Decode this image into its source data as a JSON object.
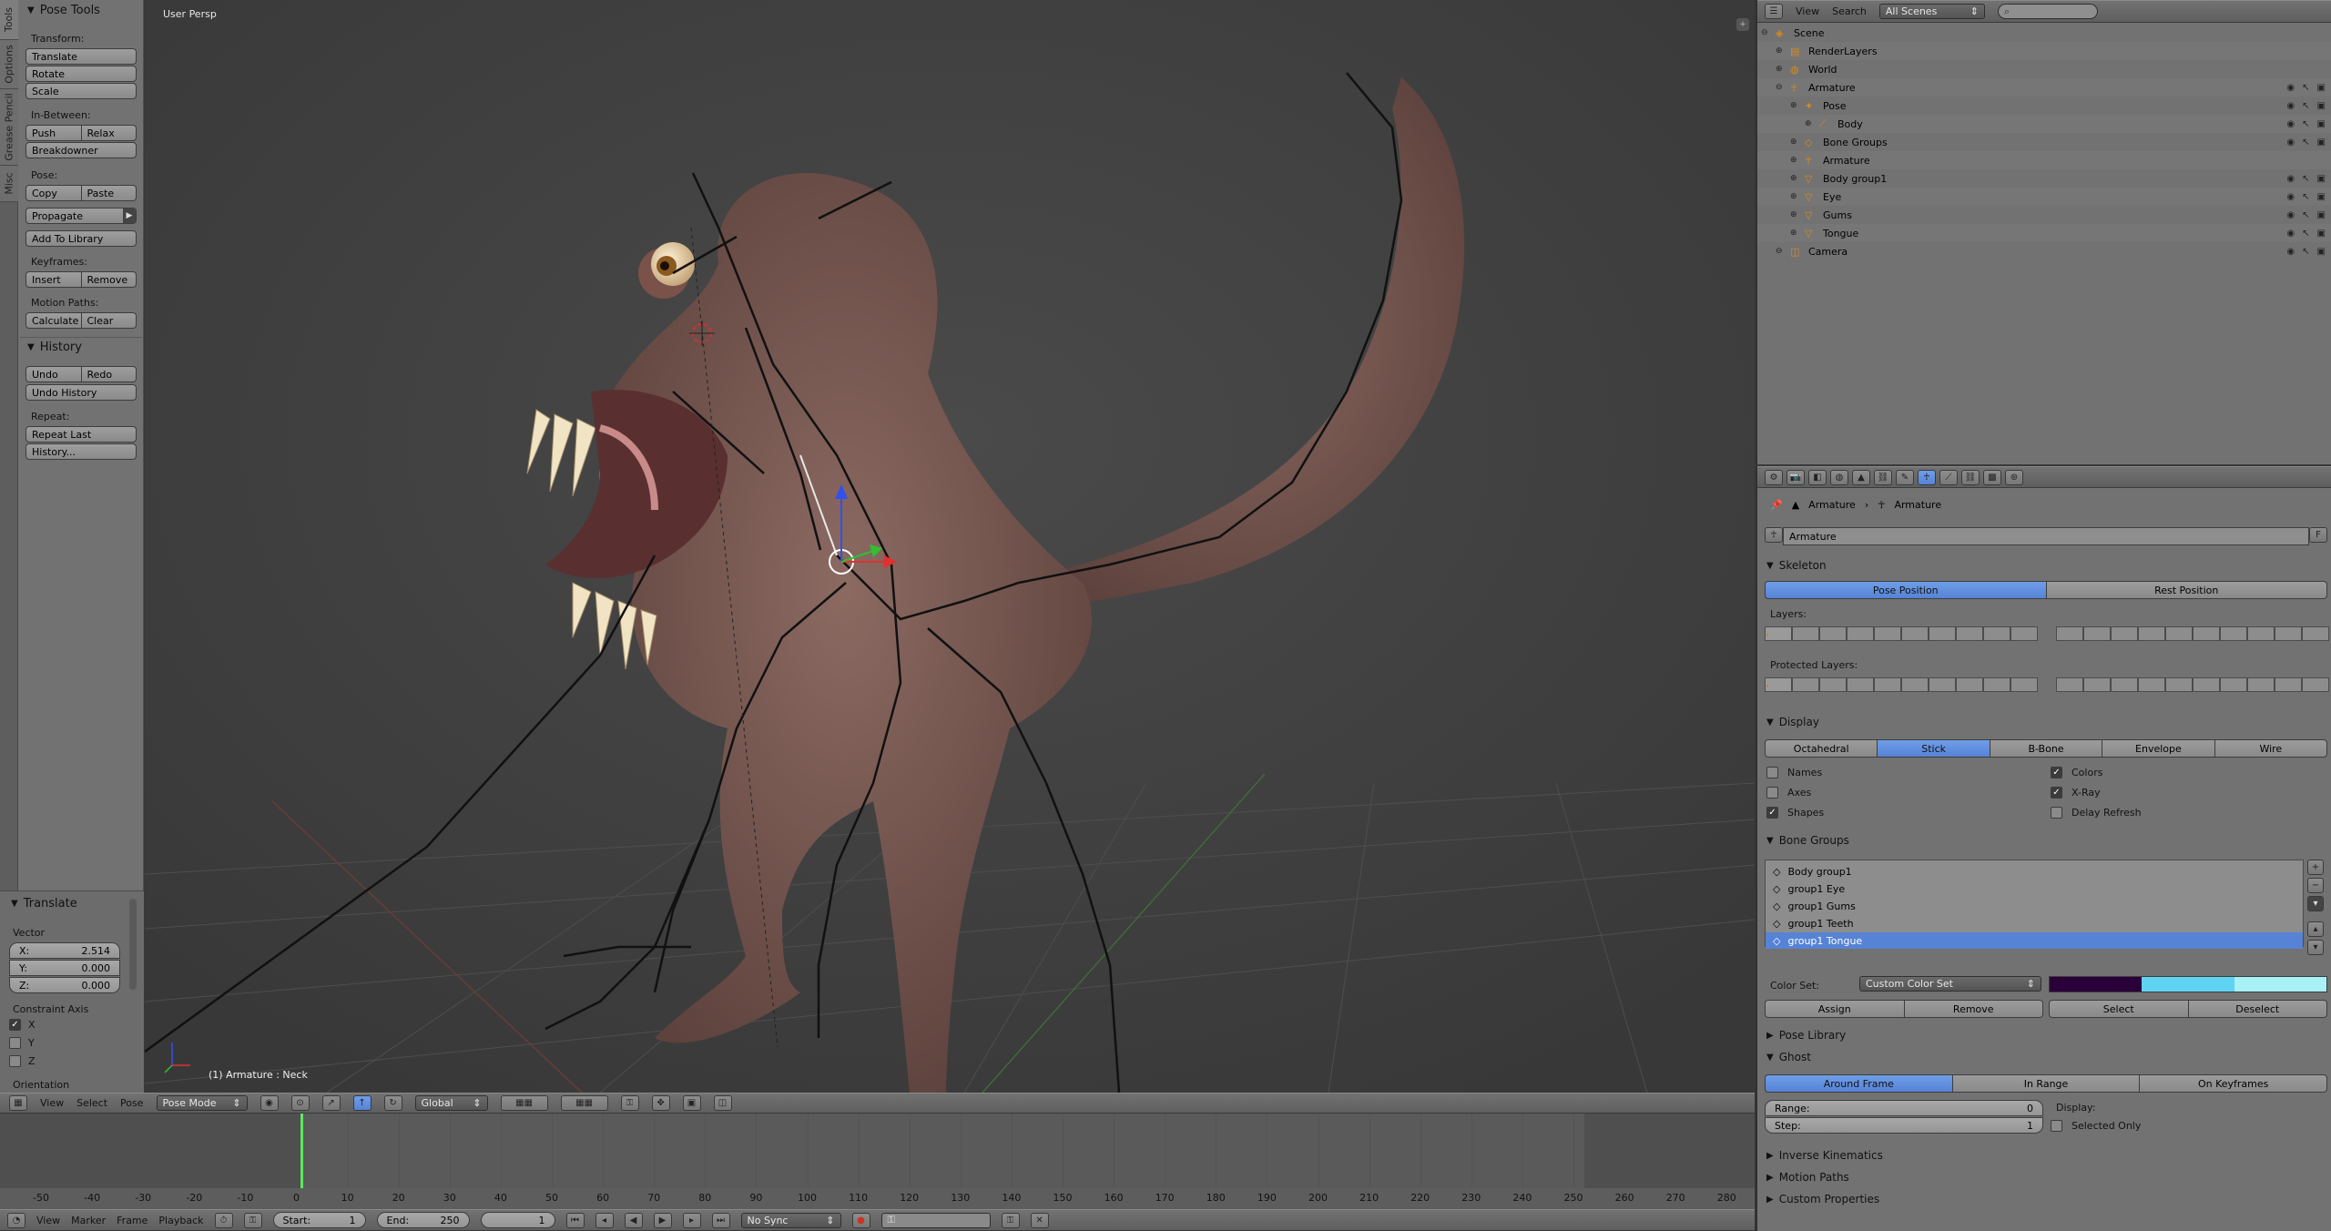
{
  "tool_shelf": {
    "tabs": [
      "Tools",
      "Options",
      "Grease Pencil",
      "Misc"
    ],
    "pose_tools_title": "Pose Tools",
    "transform_label": "Transform:",
    "translate": "Translate",
    "rotate": "Rotate",
    "scale": "Scale",
    "inbetween_label": "In-Between:",
    "push": "Push",
    "relax": "Relax",
    "breakdowner": "Breakdowner",
    "pose_label": "Pose:",
    "copy": "Copy",
    "paste": "Paste",
    "propagate": "Propagate",
    "add_to_library": "Add To Library",
    "keyframes_label": "Keyframes:",
    "insert": "Insert",
    "remove": "Remove",
    "motion_paths_label": "Motion Paths:",
    "calculate": "Calculate",
    "clear": "Clear",
    "history_title": "History",
    "undo": "Undo",
    "redo": "Redo",
    "undo_history": "Undo History",
    "repeat_label": "Repeat:",
    "repeat_last": "Repeat Last",
    "history_btn": "History..."
  },
  "operator_panel": {
    "title": "Translate",
    "vector_label": "Vector",
    "x_label": "X:",
    "x_value": "2.514",
    "y_label": "Y:",
    "y_value": "0.000",
    "z_label": "Z:",
    "z_value": "0.000",
    "constraint_label": "Constraint Axis",
    "cx": "X",
    "cy": "Y",
    "cz": "Z",
    "orientation_label": "Orientation"
  },
  "viewport": {
    "view_name": "User Persp",
    "status": "(1) Armature : Neck"
  },
  "viewport_header": {
    "view": "View",
    "select": "Select",
    "pose": "Pose",
    "mode": "Pose Mode",
    "orientation": "Global"
  },
  "outliner": {
    "view": "View",
    "search": "Search",
    "scenes_dropdown": "All Scenes",
    "rows": [
      {
        "indent": 0,
        "label": "Scene"
      },
      {
        "indent": 1,
        "label": "RenderLayers"
      },
      {
        "indent": 1,
        "label": "World"
      },
      {
        "indent": 1,
        "label": "Armature"
      },
      {
        "indent": 2,
        "label": "Pose"
      },
      {
        "indent": 3,
        "label": "Body"
      },
      {
        "indent": 2,
        "label": "Bone Groups"
      },
      {
        "indent": 2,
        "label": "Armature"
      },
      {
        "indent": 2,
        "label": "Body group1"
      },
      {
        "indent": 2,
        "label": "Eye"
      },
      {
        "indent": 2,
        "label": "Gums"
      },
      {
        "indent": 2,
        "label": "Tongue"
      },
      {
        "indent": 1,
        "label": "Camera"
      }
    ]
  },
  "properties": {
    "breadcrumb_1": "Armature",
    "breadcrumb_2": "Armature",
    "datablock_name": "Armature",
    "datablock_f": "F",
    "skeleton_title": "Skeleton",
    "pose_position": "Pose Position",
    "rest_position": "Rest Position",
    "layers_label": "Layers:",
    "protected_layers_label": "Protected Layers:",
    "display_title": "Display",
    "display_modes": [
      "Octahedral",
      "Stick",
      "B-Bone",
      "Envelope",
      "Wire"
    ],
    "names": "Names",
    "axes": "Axes",
    "shapes": "Shapes",
    "colors": "Colors",
    "xray": "X-Ray",
    "delay_refresh": "Delay Refresh",
    "bone_groups_title": "Bone Groups",
    "bone_groups": [
      "Body group1",
      "group1 Eye",
      "group1 Gums",
      "group1 Teeth",
      "group1 Tongue"
    ],
    "color_set_label": "Color Set:",
    "color_set_value": "Custom Color Set",
    "assign": "Assign",
    "remove": "Remove",
    "select": "Select",
    "deselect": "Deselect",
    "pose_library_title": "Pose Library",
    "ghost_title": "Ghost",
    "ghost_modes": [
      "Around Frame",
      "In Range",
      "On Keyframes"
    ],
    "range_label": "Range:",
    "range_value": "0",
    "step_label": "Step:",
    "step_value": "1",
    "display_label": "Display:",
    "selected_only": "Selected Only",
    "inverse_kinematics_title": "Inverse Kinematics",
    "motion_paths_title": "Motion Paths",
    "custom_properties_title": "Custom Properties",
    "colors_swatches": [
      "#2a0038",
      "#5fd3f2",
      "#a8f1f7"
    ]
  },
  "timeline": {
    "ticks": [
      "-50",
      "-40",
      "-30",
      "-20",
      "-10",
      "0",
      "10",
      "20",
      "30",
      "40",
      "50",
      "60",
      "70",
      "80",
      "90",
      "100",
      "110",
      "120",
      "130",
      "140",
      "150",
      "160",
      "170",
      "180",
      "190",
      "200",
      "210",
      "220",
      "230",
      "240",
      "250",
      "260",
      "270",
      "280"
    ],
    "current_frame": 0,
    "view": "View",
    "marker": "Marker",
    "frame": "Frame",
    "playback": "Playback",
    "start_label": "Start:",
    "start_value": "1",
    "end_label": "End:",
    "end_value": "250",
    "current_value": "1",
    "sync": "No Sync"
  }
}
